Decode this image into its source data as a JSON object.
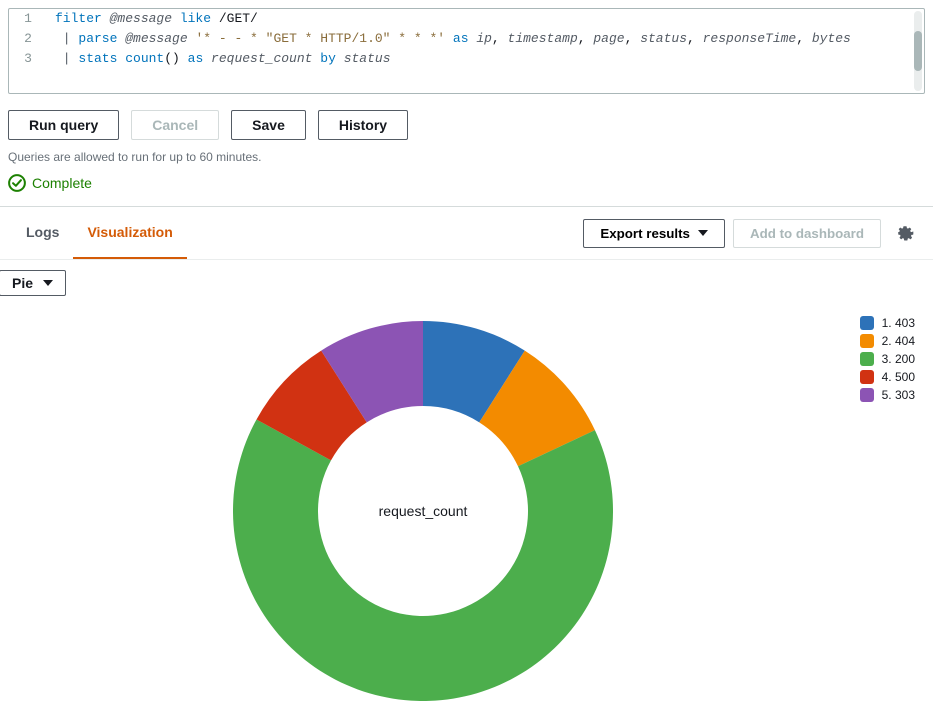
{
  "editor": {
    "lines": [
      [
        {
          "t": "filter ",
          "c": "tok-kw"
        },
        {
          "t": "@message",
          "c": "tok-field"
        },
        {
          "t": " like ",
          "c": "tok-kw"
        },
        {
          "t": "/GET/",
          "c": "tok-plain"
        }
      ],
      [
        {
          "t": " | ",
          "c": "tok-op"
        },
        {
          "t": "parse ",
          "c": "tok-kw"
        },
        {
          "t": "@message",
          "c": "tok-field"
        },
        {
          "t": " ",
          "c": "tok-plain"
        },
        {
          "t": "'* - - * \"GET * HTTP/1.0\" * * *'",
          "c": "tok-str"
        },
        {
          "t": " as ",
          "c": "tok-kw"
        },
        {
          "t": "ip",
          "c": "tok-id"
        },
        {
          "t": ", ",
          "c": "tok-plain"
        },
        {
          "t": "timestamp",
          "c": "tok-id"
        },
        {
          "t": ", ",
          "c": "tok-plain"
        },
        {
          "t": "page",
          "c": "tok-id"
        },
        {
          "t": ", ",
          "c": "tok-plain"
        },
        {
          "t": "status",
          "c": "tok-id"
        },
        {
          "t": ", ",
          "c": "tok-plain"
        },
        {
          "t": "responseTime",
          "c": "tok-id"
        },
        {
          "t": ", ",
          "c": "tok-plain"
        },
        {
          "t": "bytes",
          "c": "tok-id"
        }
      ],
      [
        {
          "t": " | ",
          "c": "tok-op"
        },
        {
          "t": "stats ",
          "c": "tok-kw"
        },
        {
          "t": "count",
          "c": "tok-fn"
        },
        {
          "t": "() ",
          "c": "tok-plain"
        },
        {
          "t": "as ",
          "c": "tok-kw"
        },
        {
          "t": "request_count",
          "c": "tok-id"
        },
        {
          "t": " by ",
          "c": "tok-kw"
        },
        {
          "t": "status",
          "c": "tok-id"
        }
      ]
    ]
  },
  "toolbar": {
    "run": "Run query",
    "cancel": "Cancel",
    "save": "Save",
    "history": "History"
  },
  "hint": "Queries are allowed to run for up to 60 minutes.",
  "status": {
    "label": "Complete"
  },
  "tabs": {
    "logs": "Logs",
    "visualization": "Visualization"
  },
  "results_bar": {
    "export": "Export results",
    "add_dashboard": "Add to dashboard"
  },
  "chart_toolbar": {
    "type_label": "Pie"
  },
  "chart_data": {
    "type": "pie",
    "title": "request_count",
    "series": [
      {
        "name": "1. 403",
        "value": 9,
        "color": "#2d72b8"
      },
      {
        "name": "2. 404",
        "value": 9,
        "color": "#f38b00"
      },
      {
        "name": "3. 200",
        "value": 65,
        "color": "#4cae4c"
      },
      {
        "name": "4. 500",
        "value": 8,
        "color": "#d13212"
      },
      {
        "name": "5. 303",
        "value": 9,
        "color": "#8c54b4"
      }
    ]
  }
}
